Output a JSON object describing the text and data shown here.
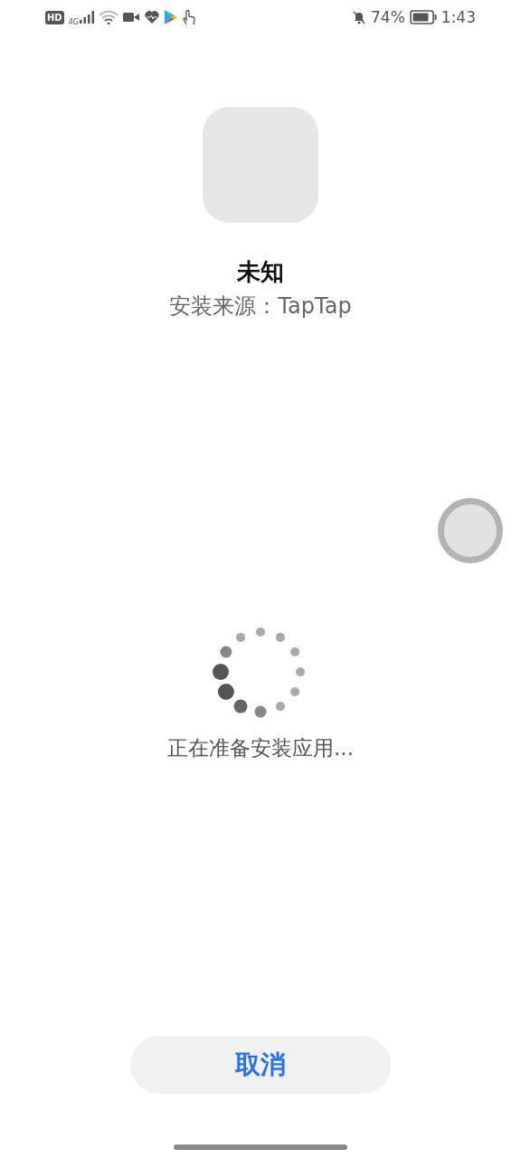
{
  "status_bar": {
    "hd_badge": "HD",
    "network": "4G",
    "battery": "74%",
    "time": "1:43"
  },
  "app": {
    "name": "未知",
    "source": "安装来源：TapTap"
  },
  "progress": {
    "message": "正在准备安装应用..."
  },
  "buttons": [
    {
      "label": "取消"
    }
  ]
}
